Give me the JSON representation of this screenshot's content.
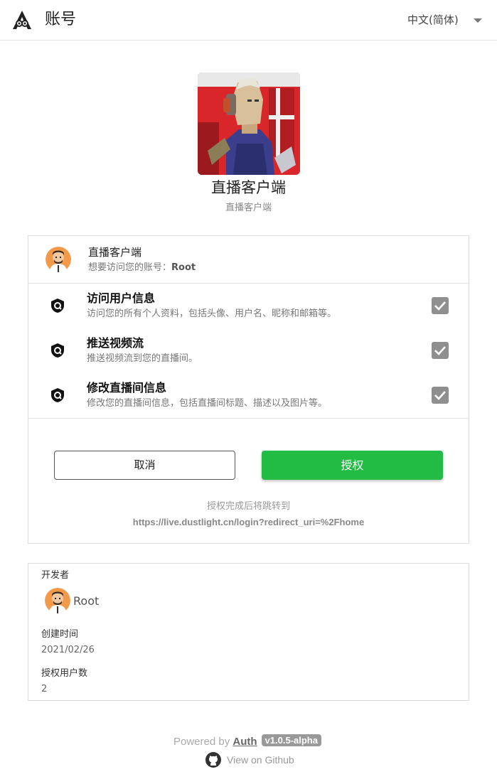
{
  "header": {
    "title": "账号",
    "language": "中文(简体)"
  },
  "app": {
    "name": "直播客户端",
    "description": "直播客户端"
  },
  "consent": {
    "client_name": "直播客户端",
    "request_text": "想要访问您的账号：",
    "account_name": "Root",
    "scopes": [
      {
        "title": "访问用户信息",
        "description": "访问您的所有个人资料，包括头像、用户名、昵称和邮箱等。",
        "checked": true
      },
      {
        "title": "推送视频流",
        "description": "推送视频流到您的直播间。",
        "checked": true
      },
      {
        "title": "修改直播间信息",
        "description": "修改您的直播间信息，包括直播间标题、描述以及图片等。",
        "checked": true
      }
    ],
    "cancel_label": "取消",
    "authorize_label": "授权",
    "redirect_label": "授权完成后将跳转到",
    "redirect_url": "https://live.dustlight.cn/login?redirect_uri=%2Fhome"
  },
  "developer": {
    "developer_label": "开发者",
    "developer_name": "Root",
    "created_label": "创建时间",
    "created_value": "2021/02/26",
    "users_label": "授权用户数",
    "users_value": "2"
  },
  "footer": {
    "powered_prefix": "Powered by",
    "brand": "Auth",
    "version": "v1.0.5-alpha",
    "github_text": "View on Github"
  },
  "colors": {
    "accent_green": "#22bb44",
    "checkbox_gray": "#8f8f8f",
    "border": "#dcdcdc"
  }
}
